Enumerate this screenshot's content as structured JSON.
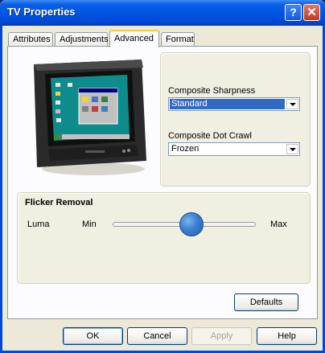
{
  "window": {
    "title": "TV Properties"
  },
  "tabs": [
    {
      "label": "Attributes"
    },
    {
      "label": "Adjustments"
    },
    {
      "label": "Advanced"
    },
    {
      "label": "Format"
    }
  ],
  "composite": {
    "sharpness_label": "Composite Sharpness",
    "sharpness_value": "Standard",
    "dot_crawl_label": "Composite Dot Crawl",
    "dot_crawl_value": "Frozen"
  },
  "flicker": {
    "title": "Flicker Removal",
    "channel_label": "Luma",
    "min_label": "Min",
    "max_label": "Max",
    "level_fraction": 0.55
  },
  "buttons": {
    "defaults": "Defaults",
    "ok": "OK",
    "cancel": "Cancel",
    "apply": "Apply",
    "help": "Help"
  },
  "colors": {
    "title_bar": "#0055e5",
    "selection": "#316ac5",
    "slider_thumb": "#3a7fd0"
  }
}
